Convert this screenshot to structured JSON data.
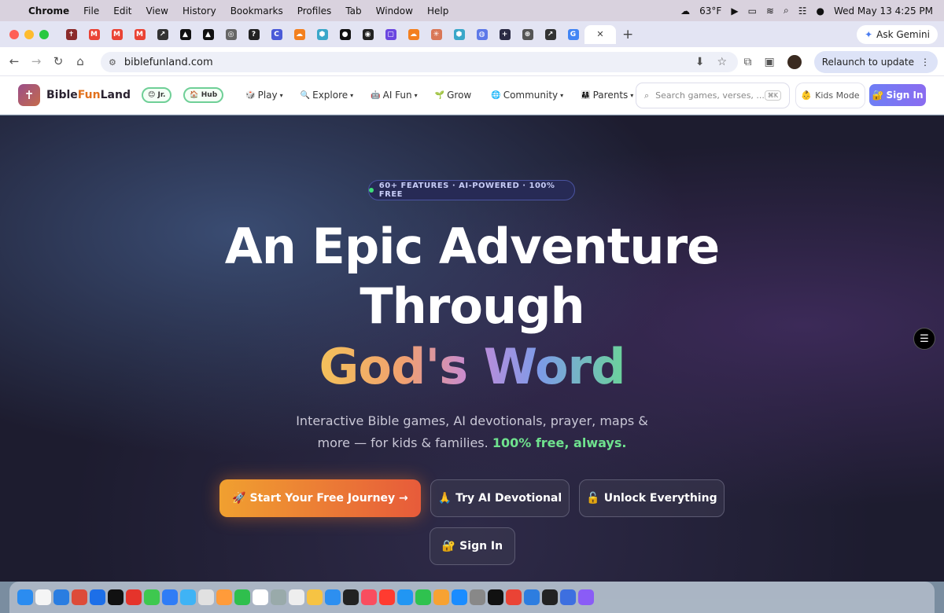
{
  "menubar": {
    "app": "Chrome",
    "items": [
      "File",
      "Edit",
      "View",
      "History",
      "Bookmarks",
      "Profiles",
      "Tab",
      "Window",
      "Help"
    ],
    "weather": "63°F",
    "datetime": "Wed May 13  4:25 PM"
  },
  "tabs": {
    "favicons": [
      {
        "glyph": "✝",
        "color": "#8b2b2b"
      },
      {
        "glyph": "M",
        "color": "#ea4335"
      },
      {
        "glyph": "M",
        "color": "#ea4335"
      },
      {
        "glyph": "M",
        "color": "#ea4335"
      },
      {
        "glyph": "↗",
        "color": "#333333"
      },
      {
        "glyph": "▲",
        "color": "#111111"
      },
      {
        "glyph": "▲",
        "color": "#111111"
      },
      {
        "glyph": "◎",
        "color": "#666666"
      },
      {
        "glyph": "?",
        "color": "#222222"
      },
      {
        "glyph": "C",
        "color": "#4a5ad8"
      },
      {
        "glyph": "☁",
        "color": "#f38020"
      },
      {
        "glyph": "⬢",
        "color": "#3aa7c9"
      },
      {
        "glyph": "●",
        "color": "#111111"
      },
      {
        "glyph": "◉",
        "color": "#222222"
      },
      {
        "glyph": "▢",
        "color": "#6b47e0"
      },
      {
        "glyph": "☁",
        "color": "#f38020"
      },
      {
        "glyph": "✳",
        "color": "#d97757"
      },
      {
        "glyph": "⬢",
        "color": "#3aa7c9"
      },
      {
        "glyph": "◍",
        "color": "#5e79e8"
      },
      {
        "glyph": "+",
        "color": "#2b2b44"
      },
      {
        "glyph": "⊛",
        "color": "#555555"
      },
      {
        "glyph": "↗",
        "color": "#333333"
      },
      {
        "glyph": "G",
        "color": "#4285f4"
      }
    ],
    "active_close": "✕",
    "new_tab": "+",
    "ask_gemini": "Ask Gemini"
  },
  "toolbar": {
    "url": "biblefunland.com",
    "relaunch": "Relaunch to update"
  },
  "site": {
    "brand_prefix": "Bible",
    "brand_fun": "Fun",
    "brand_suffix": "Land",
    "jr_pill": "😊 Jr.",
    "hub_pill": "🏠 Hub",
    "nav": [
      {
        "icon": "🎲",
        "label": "Play",
        "caret": "▾"
      },
      {
        "icon": "🔍",
        "label": "Explore",
        "caret": "▾"
      },
      {
        "icon": "🤖",
        "label": "AI Fun",
        "caret": "▾"
      },
      {
        "icon": "🌱",
        "label": "Grow",
        "caret": ""
      },
      {
        "icon": "🌐",
        "label": "Community",
        "caret": "▾"
      },
      {
        "icon": "👨‍👩‍👧",
        "label": "Parents",
        "caret": "▾"
      }
    ],
    "search_placeholder": "Search games, verses, ...",
    "search_kbd": "⌘K",
    "kids_mode": "Kids Mode",
    "sign_in": "Sign In"
  },
  "hero": {
    "badge": "60+ FEATURES · AI-POWERED · 100% FREE",
    "line1": "An Epic Adventure",
    "line2": "Through",
    "line3": "God's Word",
    "subtitle_a": "Interactive Bible games, AI devotionals, prayer, maps &",
    "subtitle_b": "more — for kids & families.",
    "subtitle_highlight": "100% free, always.",
    "cta_primary": "🚀 Start Your Free Journey →",
    "cta_devotional": "🙏 Try AI Devotional",
    "cta_unlock": "🔓 Unlock Everything",
    "cta_signin": "🔐 Sign In"
  },
  "dock": {
    "colors": [
      "#2b8cf0",
      "#f5f5f5",
      "#2a7de1",
      "#dd4b39",
      "#1d6fe8",
      "#111",
      "#e5342b",
      "#3ec84f",
      "#2f7cf6",
      "#3fb3f5",
      "#e1e1e1",
      "#ff9b3a",
      "#2fbf4d",
      "#fff",
      "#9aa",
      "#eee",
      "#f6c343",
      "#2d8ff0",
      "#222",
      "#f94d5f",
      "#ff3b30",
      "#2196f3",
      "#2fc24f",
      "#f7a232",
      "#1a8cff",
      "#888",
      "#111",
      "#ea4335",
      "#2d7de0",
      "#222",
      "#3d6fe0",
      "#8a5cf6"
    ]
  }
}
